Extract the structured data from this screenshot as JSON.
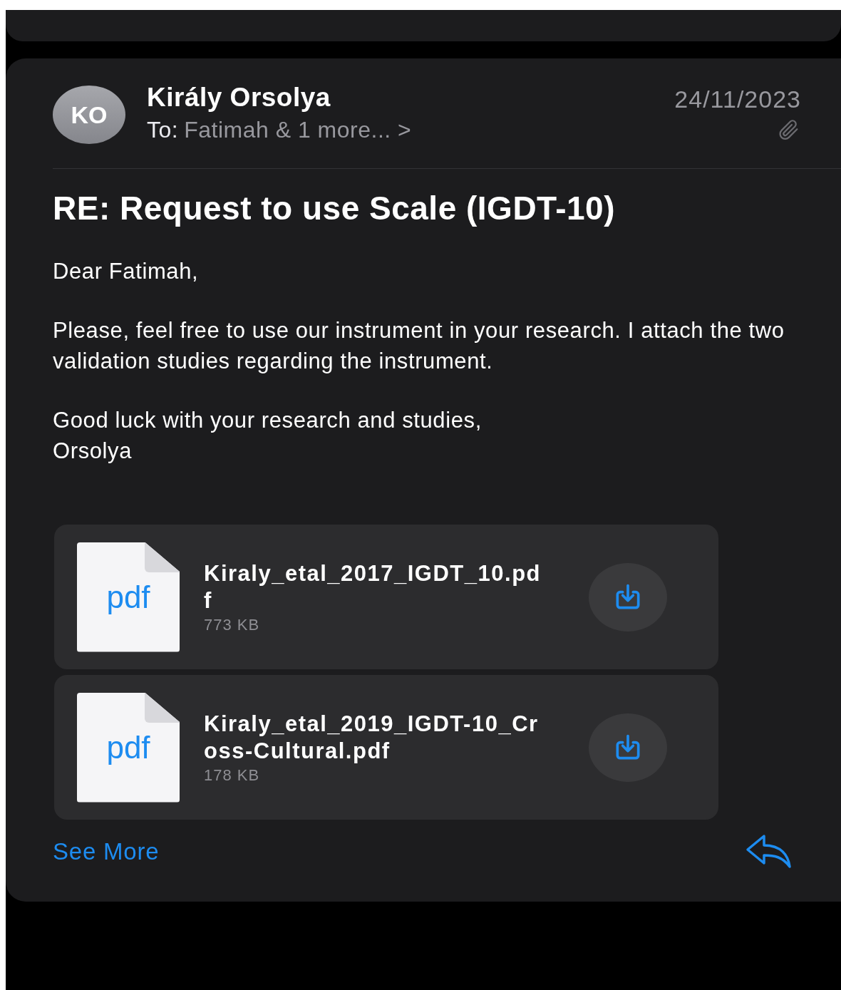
{
  "message": {
    "avatar_initials": "KO",
    "sender": "Király Orsolya",
    "to_label": "To:",
    "recipients": "Fatimah & 1 more...",
    "chevron": ">",
    "date": "24/11/2023",
    "has_attachment": true,
    "subject": "RE: Request to use Scale (IGDT-10)",
    "body": [
      "Dear Fatimah,",
      "Please, feel free to use our instrument in your research. I attach the two validation studies regarding the instrument.",
      "Good luck with your research and studies,\nOrsolya"
    ],
    "attachments": [
      {
        "file_type": "pdf",
        "name": "Kiraly_etal_2017_IGDT_10.pdf",
        "size": "773 KB"
      },
      {
        "file_type": "pdf",
        "name": "Kiraly_etal_2019_IGDT-10_Cross-Cultural.pdf",
        "size": "178 KB"
      }
    ],
    "see_more": "See More"
  }
}
